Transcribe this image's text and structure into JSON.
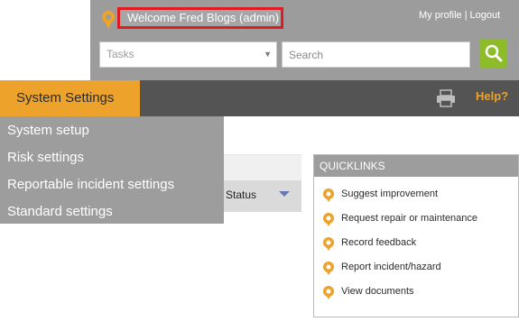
{
  "header": {
    "welcome": "Welcome Fred Blogs (admin)",
    "my_profile": "My profile",
    "separator": "|",
    "logout": "Logout"
  },
  "search": {
    "tasks_placeholder": "Tasks",
    "search_placeholder": "Search"
  },
  "nav": {
    "settings_tab": "System Settings",
    "help": "Help?"
  },
  "dropdown": {
    "items": [
      "System setup",
      "Risk settings",
      "Reportable incident settings",
      "Standard settings"
    ]
  },
  "table": {
    "status_header": "Status"
  },
  "quicklinks": {
    "title": "QUICKLINKS",
    "items": [
      "Suggest improvement",
      "Request repair or maintenance",
      "Record feedback",
      "Report incident/hazard",
      "View documents"
    ]
  },
  "colors": {
    "accent": "#eca22b",
    "header_gray": "#9c9c9c",
    "nav_dark": "#545454",
    "search_green": "#8cbd29",
    "highlight_red": "#e01b24"
  }
}
